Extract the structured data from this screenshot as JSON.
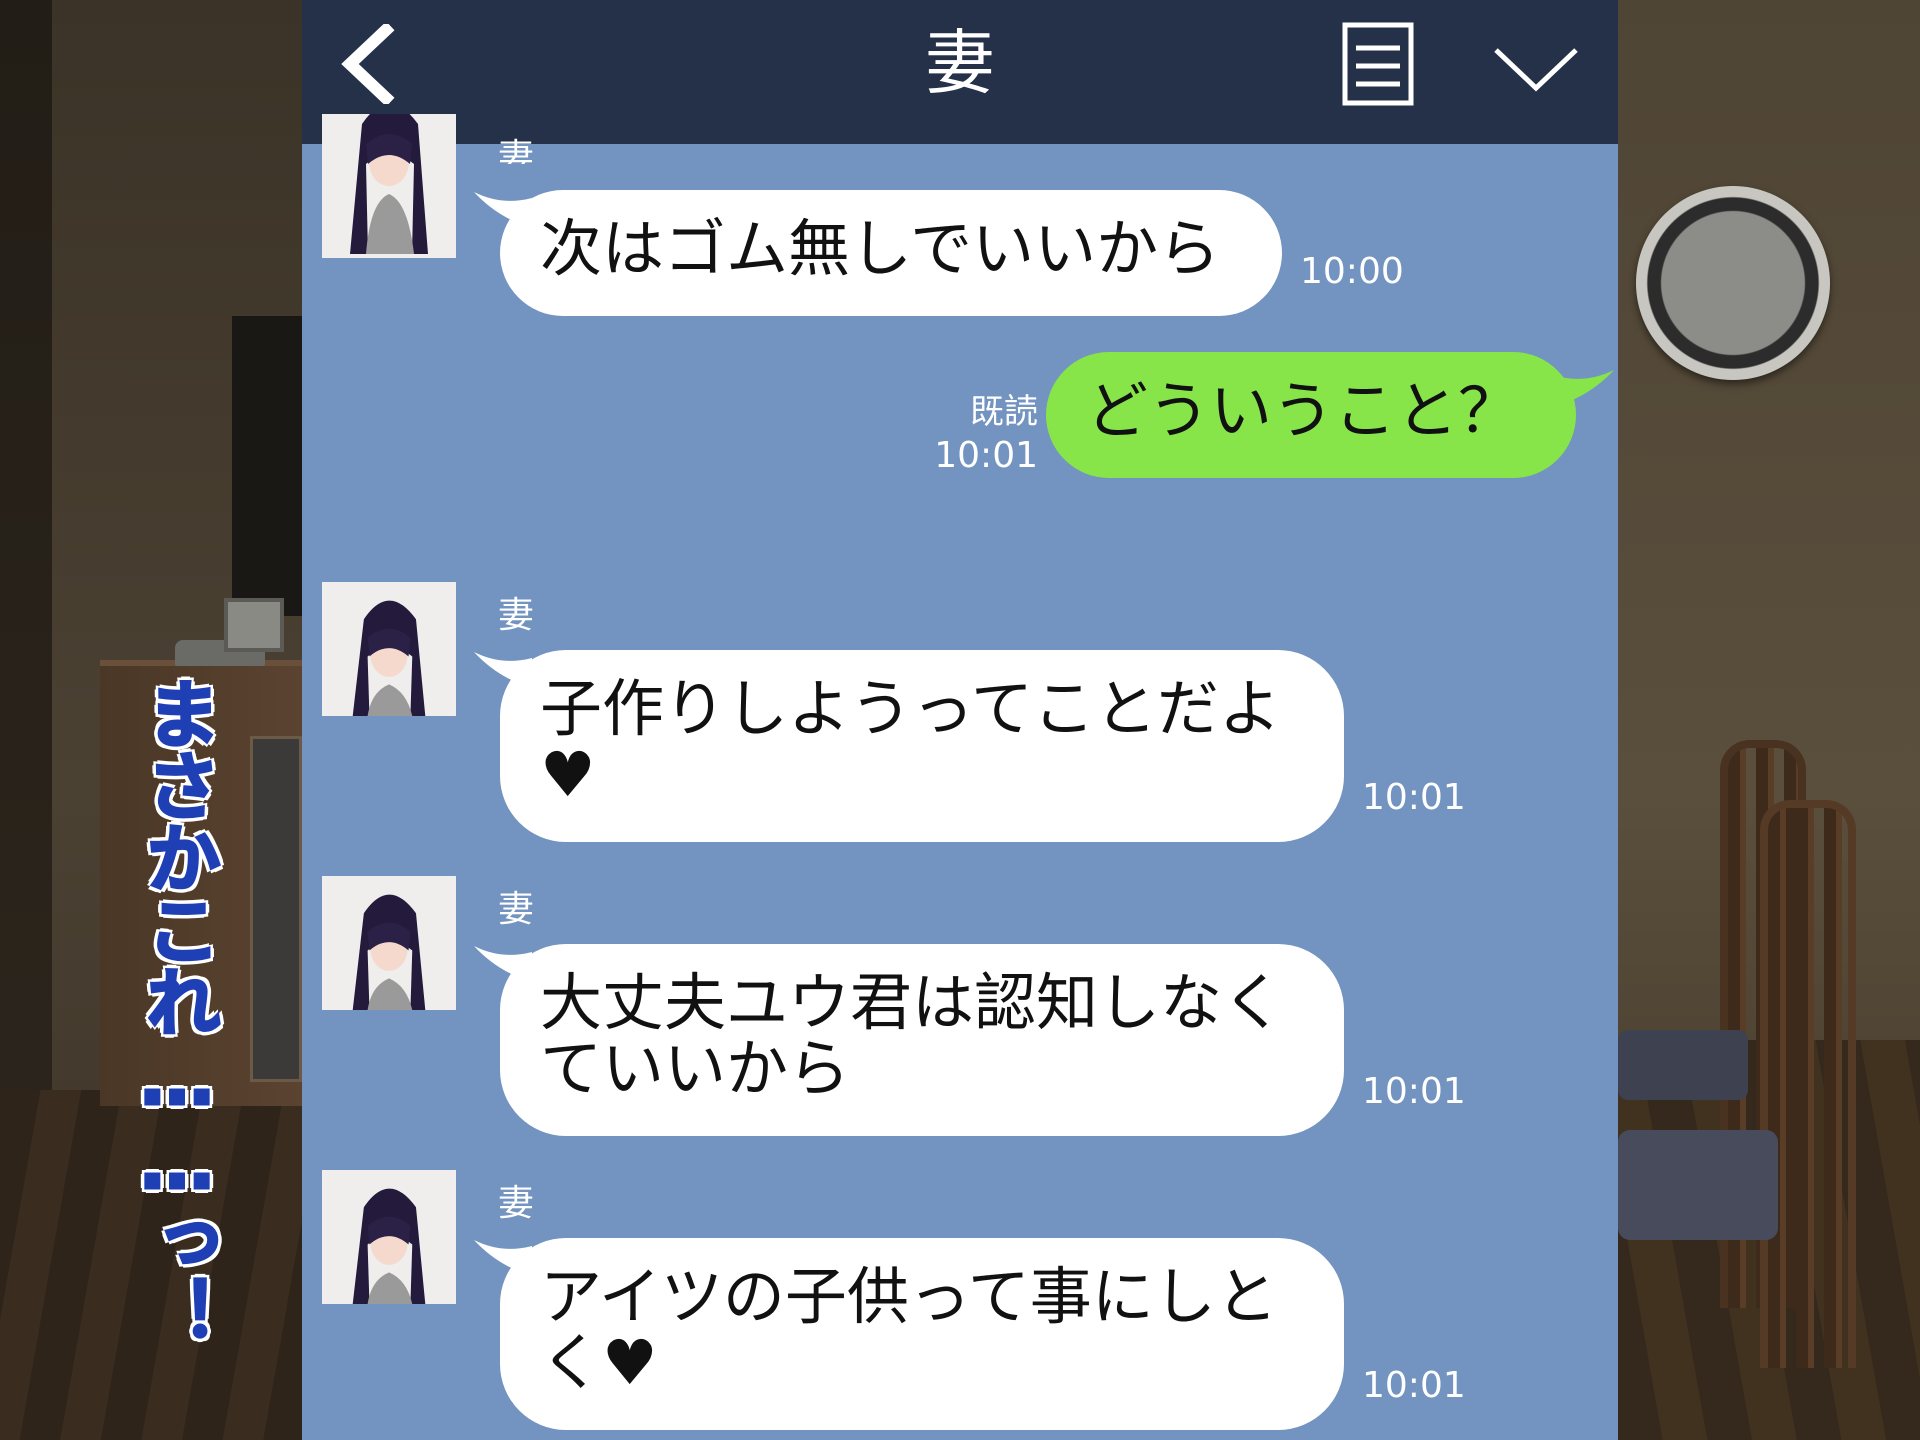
{
  "header": {
    "title": "妻"
  },
  "messages": [
    {
      "sender": "妻",
      "text": "次はゴム無しでいいから",
      "time": "10:00"
    },
    {
      "sender": "me",
      "text": "どういうこと？",
      "read_label": "既読",
      "time": "10:01"
    },
    {
      "sender": "妻",
      "text": "子作りしようってことだよ♥",
      "time": "10:01"
    },
    {
      "sender": "妻",
      "text": "大丈夫ユウ君は認知しなくていいから",
      "time": "10:01"
    },
    {
      "sender": "妻",
      "text": "アイツの子供って事にしとく♥",
      "time": "10:01"
    }
  ],
  "overlay": {
    "shout_text": "まさかこれ……っ！",
    "shout_color": "#1f3fb5"
  },
  "colors": {
    "header_bg": "#243149",
    "chat_bg": "#7394c0",
    "my_bubble": "#87e54a",
    "their_bubble": "#ffffff"
  }
}
